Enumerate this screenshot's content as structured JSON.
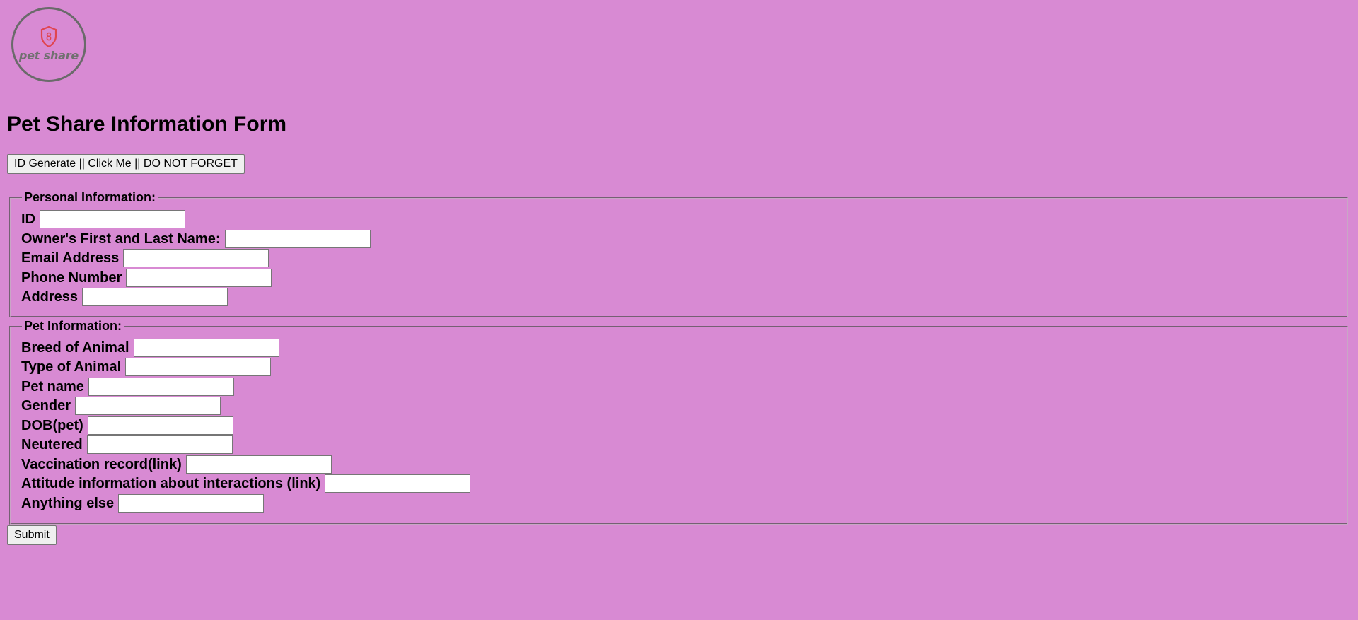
{
  "logo": {
    "icon": "shield-icon",
    "text": "pet share",
    "accent": "#e0454f"
  },
  "page_title": "Pet Share Information Form",
  "id_button_label": "ID Generate || Click Me || DO NOT FORGET",
  "personal": {
    "legend": "Personal Information:",
    "fields": [
      {
        "label": "ID",
        "value": ""
      },
      {
        "label": "Owner's First and Last Name:",
        "value": ""
      },
      {
        "label": "Email Address",
        "value": ""
      },
      {
        "label": "Phone Number",
        "value": ""
      },
      {
        "label": "Address",
        "value": ""
      }
    ]
  },
  "pet": {
    "legend": "Pet Information:",
    "fields": [
      {
        "label": "Breed of Animal",
        "value": ""
      },
      {
        "label": "Type of Animal",
        "value": ""
      },
      {
        "label": "Pet name",
        "value": ""
      },
      {
        "label": "Gender",
        "value": ""
      },
      {
        "label": "DOB(pet)",
        "value": ""
      },
      {
        "label": "Neutered",
        "value": ""
      },
      {
        "label": "Vaccination record(link)",
        "value": ""
      },
      {
        "label": "Attitude information about interactions (link)",
        "value": ""
      },
      {
        "label": "Anything else",
        "value": ""
      }
    ]
  },
  "submit_label": "Submit",
  "colors": {
    "background": "#d88ad3",
    "logo_border": "#6a6a6a"
  }
}
